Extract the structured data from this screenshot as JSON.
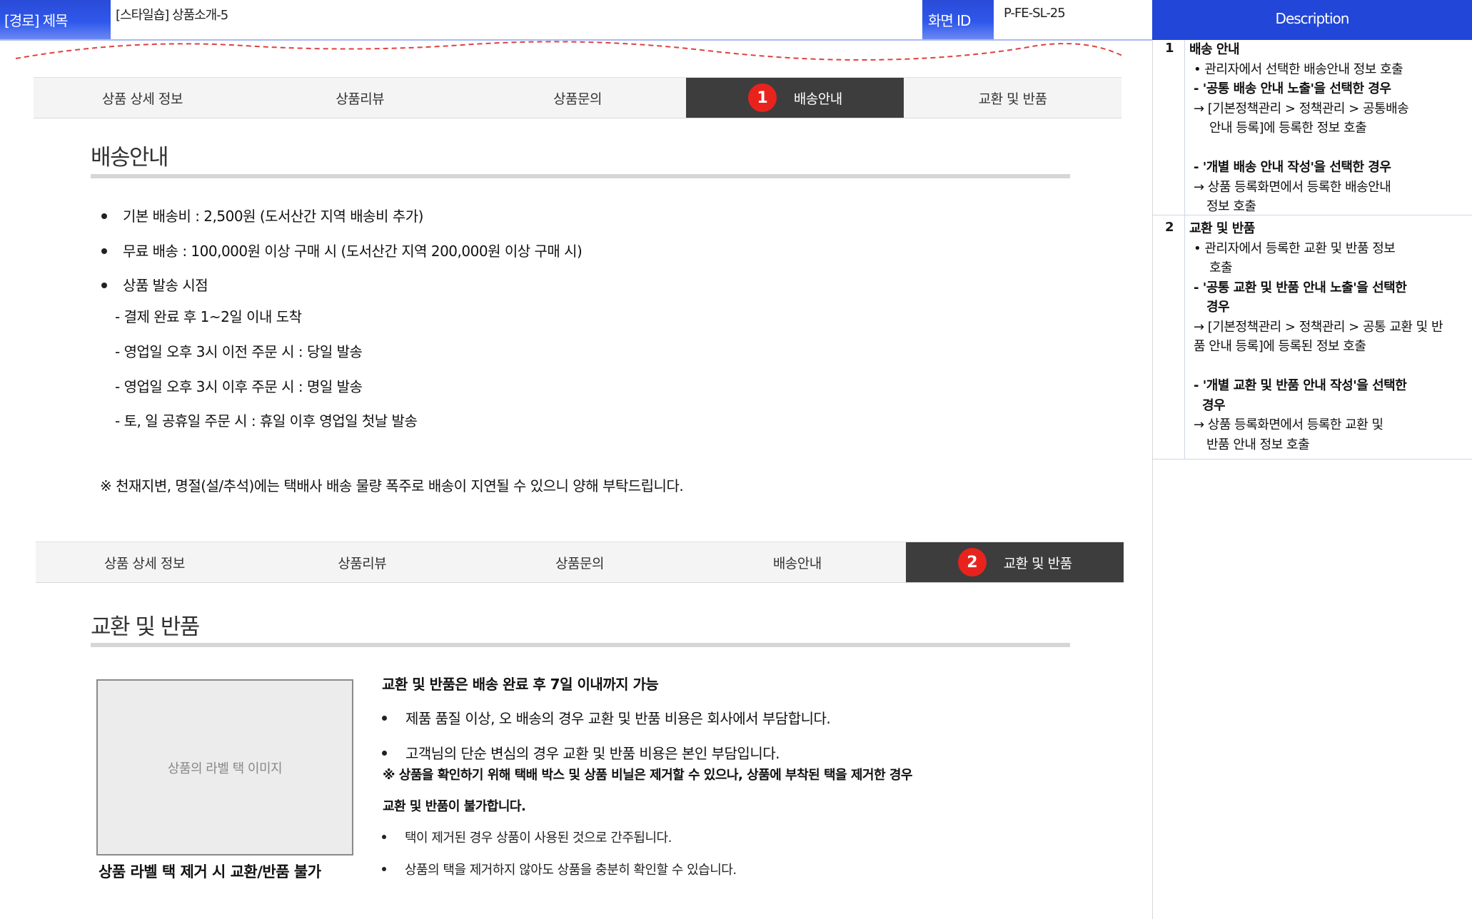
{
  "header": {
    "path_label": "[경로] 제목",
    "page_title": "[스타일숍] 상품소개-5",
    "screen_id_label": "화면 ID",
    "screen_id": "P-FE-SL-25",
    "description_label": "Description"
  },
  "tabs_shipping": {
    "items": [
      "상품 상세 정보",
      "상품리뷰",
      "상품문의",
      "배송안내",
      "교환 및 반품"
    ],
    "active_number": "1"
  },
  "shipping": {
    "title": "배송안내",
    "bullets": [
      "기본 배송비 : 2,500원 (도서산간 지역 배송비 추가)",
      "무료 배송 : 100,000원 이상 구매 시 (도서산간 지역 200,000원 이상 구매 시)",
      "상품 발송 시점"
    ],
    "sublines": [
      "- 결제 완료 후 1~2일 이내 도착",
      "- 영업일 오후 3시 이전 주문 시 : 당일 발송",
      "- 영업일 오후 3시 이후 주문 시 : 명일 발송",
      "- 토, 일 공휴일 주문 시  : 휴일 이후 영업일 첫날 발송"
    ],
    "notice": "※ 천재지변, 명절(설/추석)에는 택배사 배송 물량 폭주로 배송이 지연될 수 있으니 양해 부탁드립니다."
  },
  "tabs_exchange": {
    "items": [
      "상품 상세 정보",
      "상품리뷰",
      "상품문의",
      "배송안내",
      "교환 및 반품"
    ],
    "active_number": "2"
  },
  "exchange": {
    "title": "교환 및 반품",
    "image_placeholder": "상품의 라벨 택 이미지",
    "image_caption": "상품 라벨 택 제거 시 교환/반품 불가",
    "heading": "교환 및 반품은 배송 완료 후 7일 이내까지 가능",
    "bullets": [
      "제품 품질 이상, 오 배송의 경우 교환 및 반품 비용은 회사에서 부담합니다.",
      "고객님의 단순 변심의 경우 교환 및 반품 비용은 본인 부담입니다."
    ],
    "warning_line1": "※ 상품을 확인하기 위해 택배 박스 및 상품 비닐은 제거할 수 있으나, 상품에 부착된 택을 제거한 경우",
    "warning_line2": "교환 및 반품이 불가합니다.",
    "small_bullets": [
      "택이 제거된 경우 상품이 사용된 것으로 간주됩니다.",
      "상품의 택을 제거하지 않아도 상품을 충분히 확인할 수 있습니다."
    ]
  },
  "description": {
    "rows": [
      {
        "index": "1",
        "title": "배송 안내",
        "lines": [
          "• 관리자에서 선택한 배송안내 정보 호출",
          "- '공통 배송 안내 노출'을 선택한 경우",
          "→ [기본정책관리 > 정책관리 > 공통배송",
          "안내 등록]에 등록한 정보 호출",
          "- '개별 배송 안내 작성'을 선택한 경우",
          "→ 상품 등록화면에서 등록한 배송안내",
          "정보 호출"
        ]
      },
      {
        "index": "2",
        "title": "교환 및 반품",
        "lines": [
          "• 관리자에서 등록한 교환 및 반품 정보",
          "호출",
          "- '공통 교환 및 반품 안내 노출'을 선택한",
          "경우",
          "→ [기본정책관리 > 정책관리 > 공통 교환 및 반",
          "품 안내 등록]에 등록된 정보 호출",
          "- '개별 교환 및 반품 안내 작성'을 선택한",
          "경우",
          "→ 상품 등록화면에서 등록한 교환 및",
          "반품 안내 정보 호출"
        ]
      }
    ]
  },
  "colors": {
    "header_blue": "#2146d8",
    "active_tab": "#3d3d3d",
    "marker_red": "#e8231d",
    "wavy_red": "#e04040"
  }
}
